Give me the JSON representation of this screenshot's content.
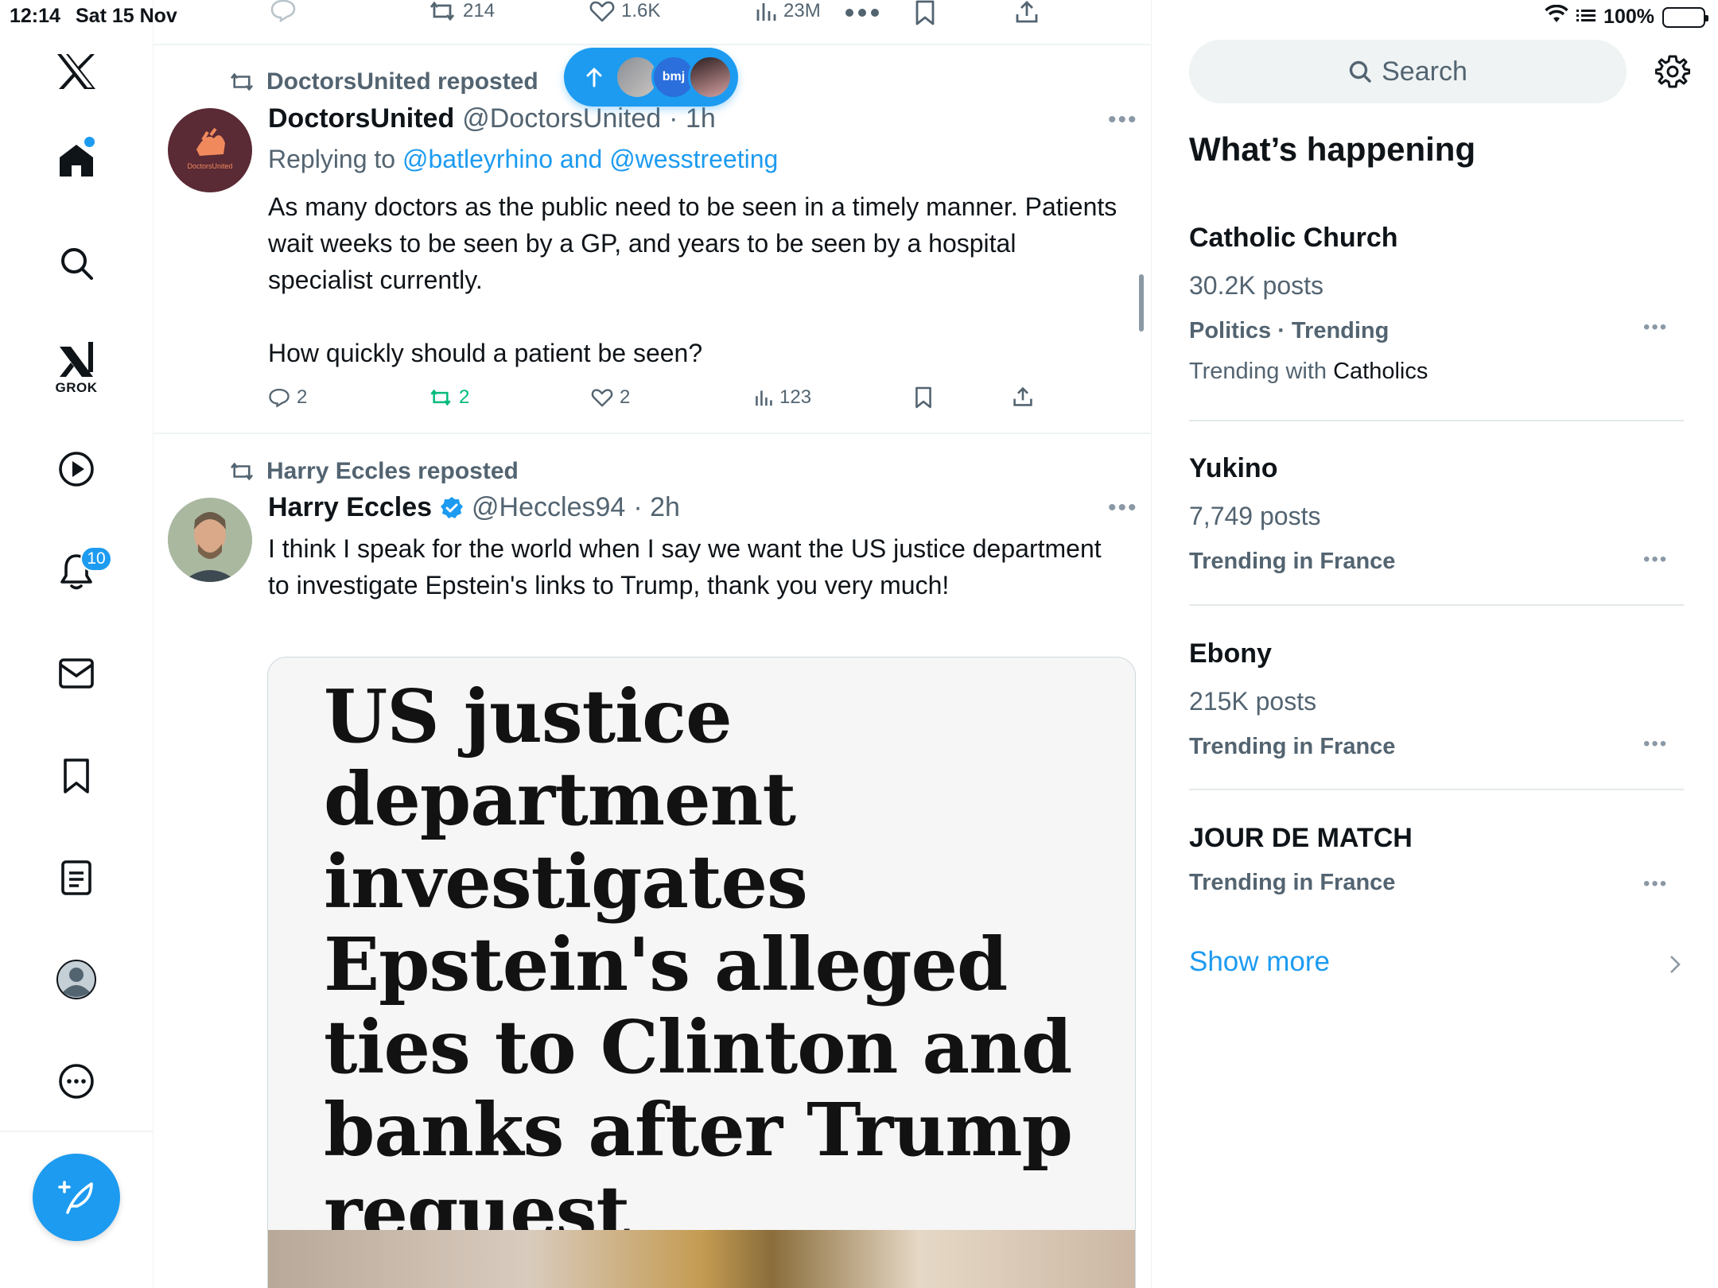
{
  "status_bar": {
    "time": "12:14",
    "date": "Sat 15 Nov",
    "battery": "100%"
  },
  "nav": {
    "grok_label": "GROK",
    "notifications_badge": "10"
  },
  "top_partial_tweet": {
    "reposts": "214",
    "likes": "1.6K",
    "views": "23M"
  },
  "new_posts_pill": {
    "avatar_text": "bmj"
  },
  "tweets": [
    {
      "repost_by": "DoctorsUnited reposted",
      "name": "DoctorsUnited",
      "handle": "@DoctorsUnited",
      "time": "· 1h",
      "reply_prefix": "Replying to ",
      "reply_targets": "@batleyrhino and @wesstreeting",
      "avatar_text": "DoctorsUnited",
      "text": "As many doctors as the public need to be seen in a timely manner. Patients wait weeks to be seen by a GP, and years to be seen by a hospital specialist currently.\n\nHow quickly should a patient be seen?",
      "replies": "2",
      "reposts": "2",
      "likes": "2",
      "views": "123"
    },
    {
      "repost_by": "Harry Eccles reposted",
      "name": "Harry Eccles",
      "handle": "@Heccles94",
      "time": "· 2h",
      "text": "I think I speak for the world when I say we want the US justice department to investigate Epstein's links to Trump, thank you very much!",
      "card_headline": "US justice department investigates Epstein's alleged ties to Clinton and banks after Trump request"
    }
  ],
  "sidebar": {
    "search_placeholder": "Search",
    "title": "What’s happening",
    "trends": [
      {
        "title": "Catholic Church",
        "posts": "30.2K posts",
        "context": "Politics · Trending",
        "with_prefix": "Trending with ",
        "with_topic": "Catholics"
      },
      {
        "title": "Yukino",
        "posts": "7,749 posts",
        "context": "Trending in France"
      },
      {
        "title": "Ebony",
        "posts": "215K posts",
        "context": "Trending in France"
      },
      {
        "title": "JOUR DE MATCH",
        "context": "Trending in France"
      }
    ],
    "show_more": "Show more"
  },
  "colors": {
    "accent": "#1d9bf0",
    "repost_green": "#00ba7c",
    "secondary_text": "#536471"
  }
}
